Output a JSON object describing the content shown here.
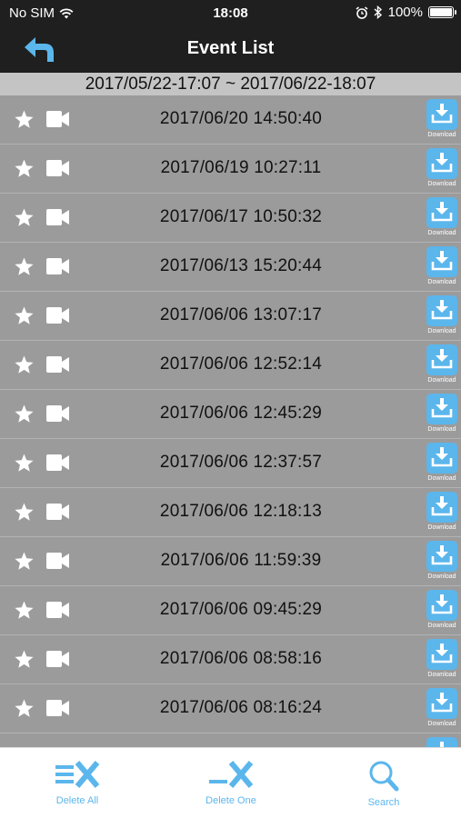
{
  "status": {
    "carrier": "No SIM",
    "time": "18:08",
    "battery": "100%",
    "battery_level": 1.0
  },
  "nav": {
    "title": "Event List",
    "back_icon": "back-arrow-icon"
  },
  "range": {
    "text": "2017/05/22-17:07 ~ 2017/06/22-18:07"
  },
  "events": [
    {
      "datetime": "2017/06/20  14:50:40",
      "download_label": "Download"
    },
    {
      "datetime": "2017/06/19  10:27:11",
      "download_label": "Download"
    },
    {
      "datetime": "2017/06/17  10:50:32",
      "download_label": "Download"
    },
    {
      "datetime": "2017/06/13  15:20:44",
      "download_label": "Download"
    },
    {
      "datetime": "2017/06/06  13:07:17",
      "download_label": "Download"
    },
    {
      "datetime": "2017/06/06  12:52:14",
      "download_label": "Download"
    },
    {
      "datetime": "2017/06/06  12:45:29",
      "download_label": "Download"
    },
    {
      "datetime": "2017/06/06  12:37:57",
      "download_label": "Download"
    },
    {
      "datetime": "2017/06/06  12:18:13",
      "download_label": "Download"
    },
    {
      "datetime": "2017/06/06  11:59:39",
      "download_label": "Download"
    },
    {
      "datetime": "2017/06/06  09:45:29",
      "download_label": "Download"
    },
    {
      "datetime": "2017/06/06  08:58:16",
      "download_label": "Download"
    },
    {
      "datetime": "2017/06/06  08:16:24",
      "download_label": "Download"
    },
    {
      "datetime": "",
      "download_label": ""
    }
  ],
  "toolbar": {
    "delete_all": "Delete All",
    "delete_one": "Delete One",
    "search": "Search"
  },
  "colors": {
    "accent": "#5bb6ec",
    "header": "#1f1f1f",
    "row_bg": "#9b9b9b",
    "range_bg": "#c4c4c4"
  }
}
